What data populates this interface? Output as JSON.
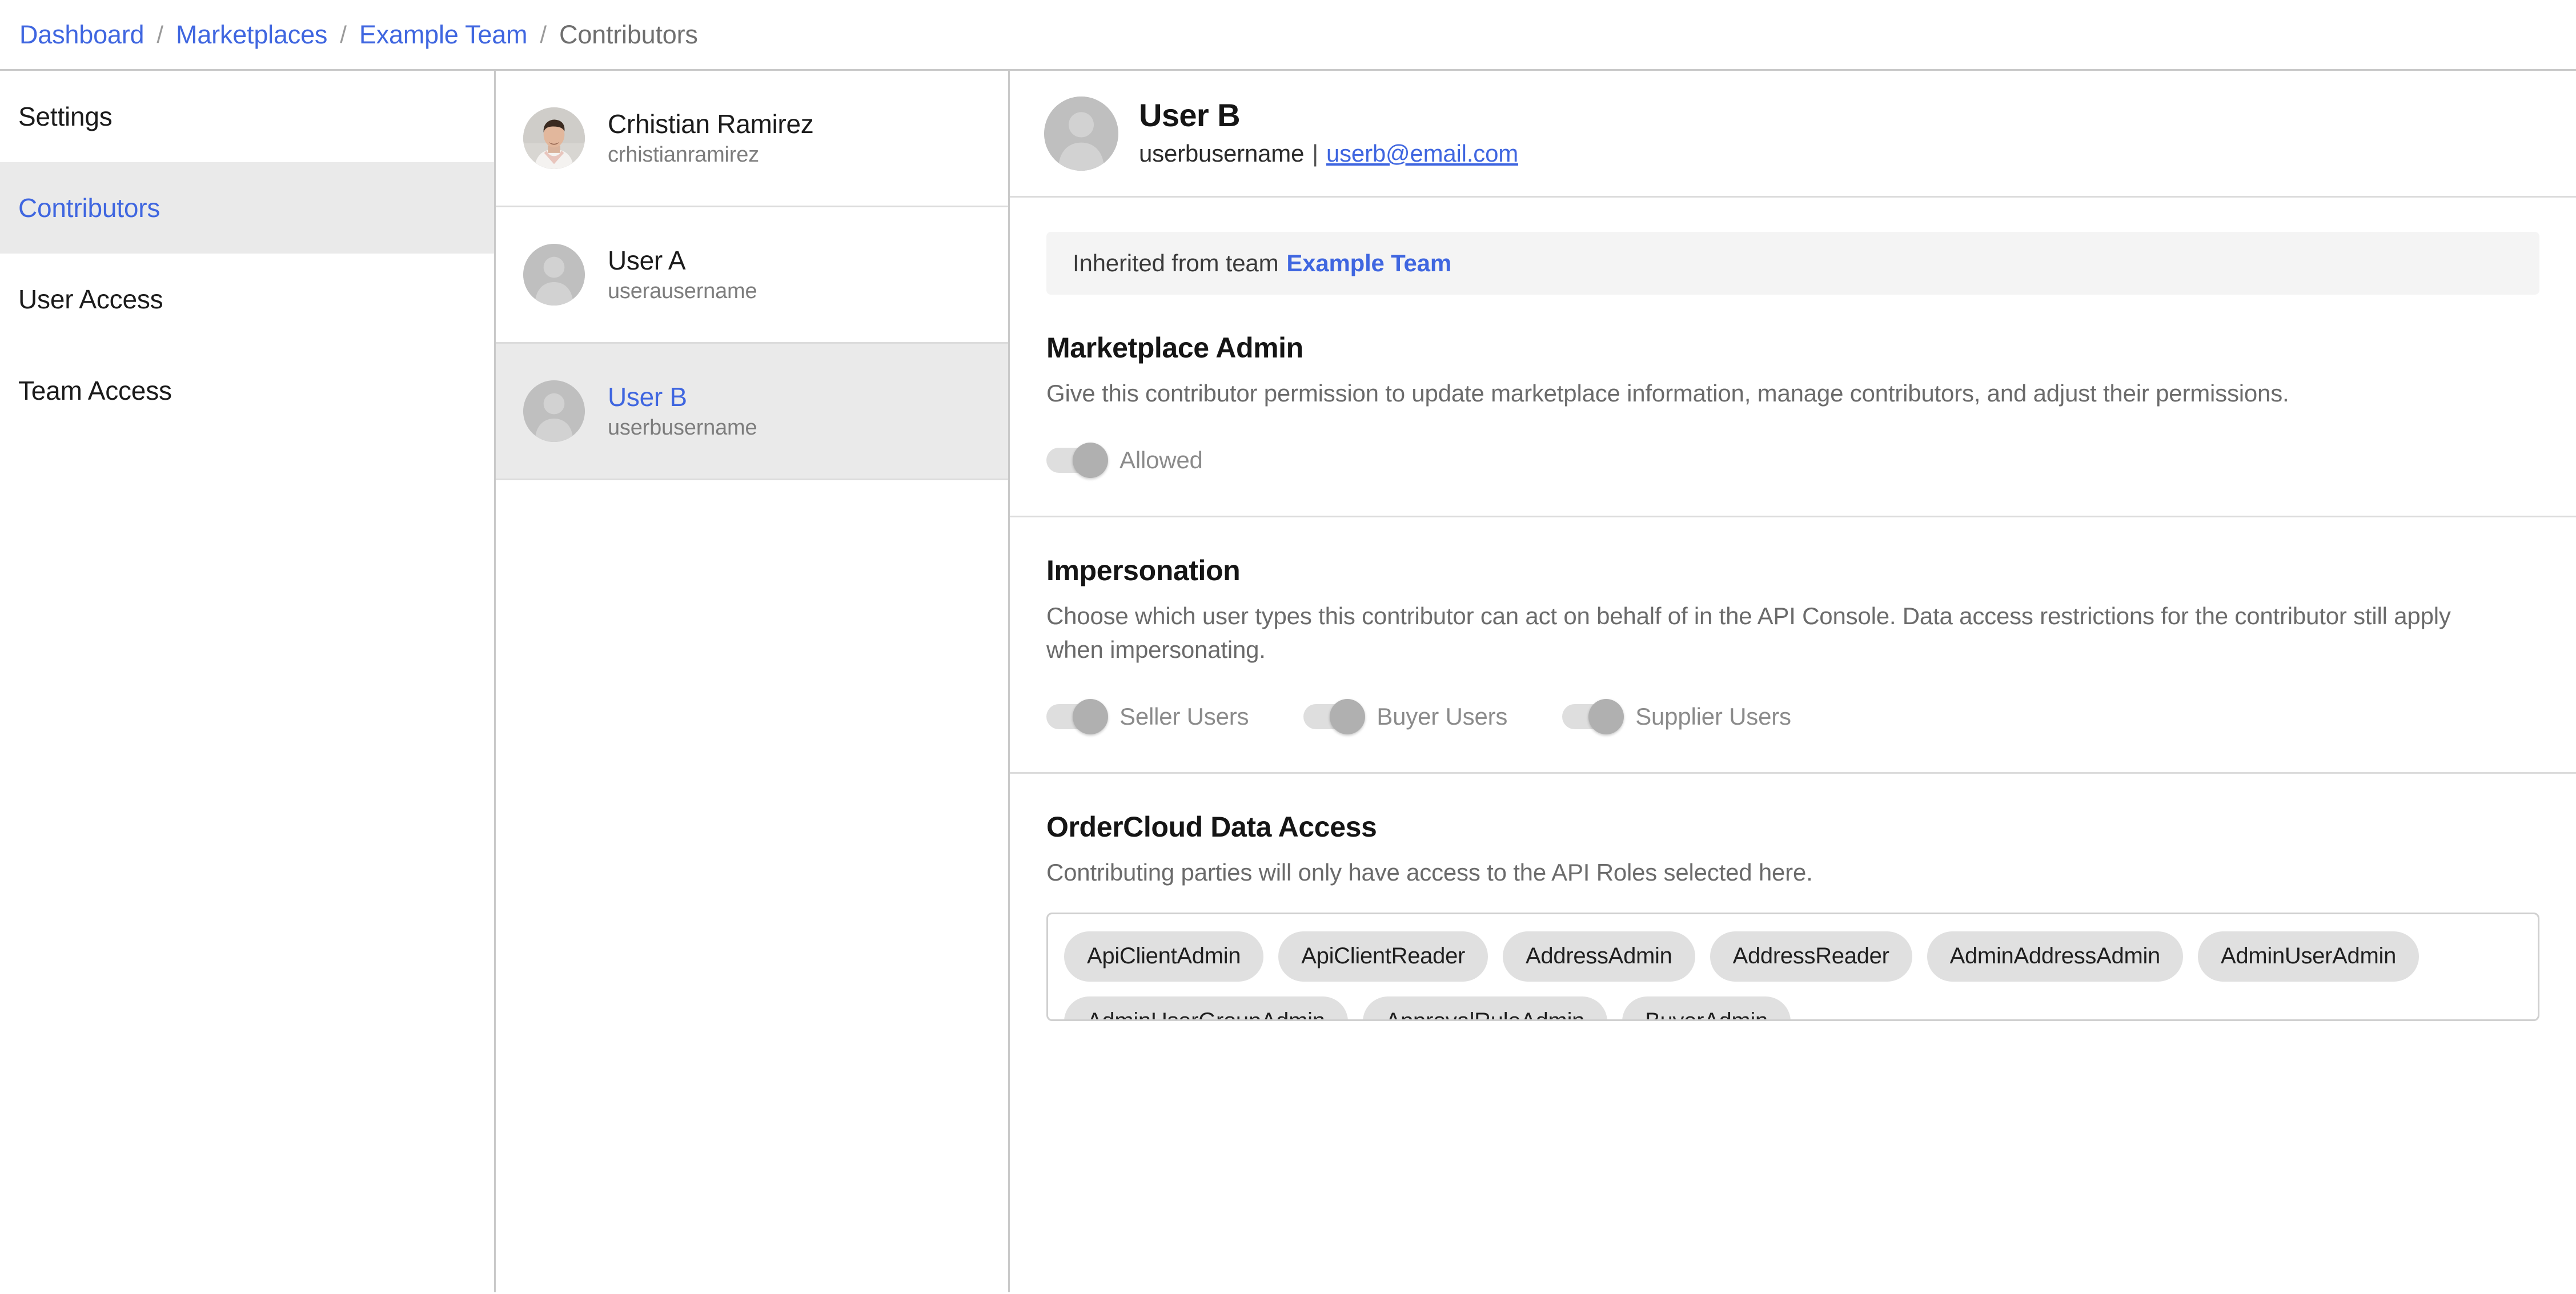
{
  "breadcrumb": {
    "separator": "/",
    "items": [
      {
        "label": "Dashboard",
        "current": false
      },
      {
        "label": "Marketplaces",
        "current": false
      },
      {
        "label": "Example Team",
        "current": false
      },
      {
        "label": "Contributors",
        "current": true
      }
    ]
  },
  "sidebar": {
    "items": [
      {
        "label": "Settings",
        "active": false
      },
      {
        "label": "Contributors",
        "active": true
      },
      {
        "label": "User Access",
        "active": false
      },
      {
        "label": "Team Access",
        "active": false
      }
    ]
  },
  "contributor_list": [
    {
      "name": "Crhistian Ramirez",
      "username": "crhistianramirez",
      "avatar": "photo-avatar",
      "selected": false
    },
    {
      "name": "User A",
      "username": "userausername",
      "avatar": "person-placeholder-icon",
      "selected": false
    },
    {
      "name": "User B",
      "username": "userbusername",
      "avatar": "person-placeholder-icon",
      "selected": true
    }
  ],
  "detail": {
    "avatar": "person-placeholder-icon",
    "name": "User B",
    "username": "userbusername",
    "separator": "|",
    "email": "userb@email.com",
    "banner": {
      "prefix": "Inherited from team",
      "team": "Example Team"
    },
    "sections": [
      {
        "title": "Marketplace Admin",
        "description": "Give this contributor permission to update marketplace information, manage contributors, and adjust their permissions.",
        "toggles": [
          {
            "label": "Allowed",
            "state": "on-disabled"
          }
        ]
      },
      {
        "title": "Impersonation",
        "description": "Choose which user types this contributor can act on behalf of in the API Console. Data access restrictions for the contributor still apply when impersonating.",
        "toggles": [
          {
            "label": "Seller Users",
            "state": "on-disabled"
          },
          {
            "label": "Buyer Users",
            "state": "on-disabled"
          },
          {
            "label": "Supplier Users",
            "state": "on-disabled"
          }
        ]
      },
      {
        "title": "OrderCloud Data Access",
        "description": "Contributing parties will only have access to the API Roles selected here.",
        "chips": [
          "ApiClientAdmin",
          "ApiClientReader",
          "AddressAdmin",
          "AddressReader",
          "AdminAddressAdmin",
          "AdminUserAdmin",
          "AdminUserGroupAdmin",
          "ApprovalRuleAdmin",
          "BuyerAdmin"
        ]
      }
    ]
  },
  "colors": {
    "link": "#3f66e0",
    "selected_row_bg": "#eaeaea",
    "banner_bg": "#f4f4f4",
    "chip_bg": "#e0e0e0",
    "divider": "#dcdcdc",
    "muted_text": "#6b6b6b",
    "toggle_track": "#dedede",
    "toggle_knob": "#b0b0b0"
  }
}
